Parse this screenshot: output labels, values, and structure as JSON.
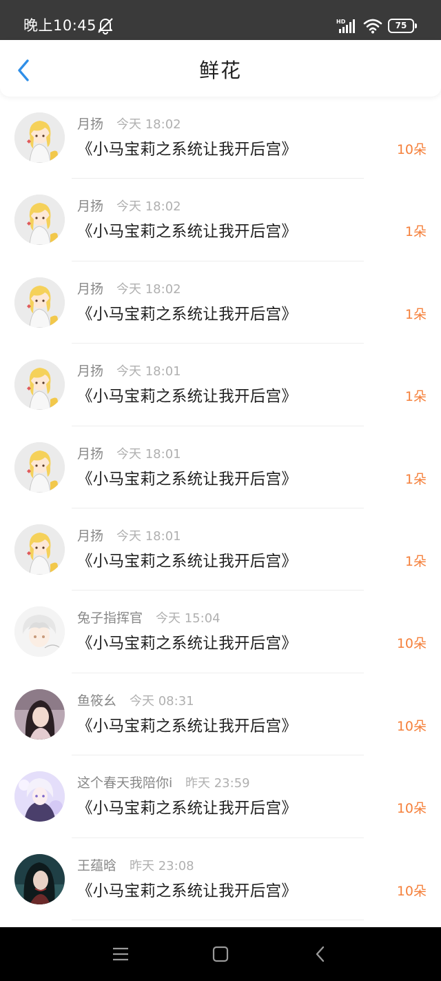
{
  "status_bar": {
    "time": "晚上10:45",
    "icons": [
      "mute-icon",
      "hd-signal-icon",
      "wifi-icon",
      "battery-icon"
    ],
    "battery_level": "75"
  },
  "header": {
    "back_icon": "chevron-left-icon",
    "title": "鲜花"
  },
  "colors": {
    "accent": "#2f8fe8",
    "flower_count": "#f5803b",
    "username": "#888888",
    "timestamp": "#b0b0b0",
    "status_bar_bg": "#3a3a3a",
    "nav_bar_bg": "#000000"
  },
  "items": [
    {
      "user": "月扬",
      "time": "今天 18:02",
      "book": "《小马宝莉之系统让我开后宫》",
      "count": "10朵",
      "avatar": "anime-avatar-blonde"
    },
    {
      "user": "月扬",
      "time": "今天 18:02",
      "book": "《小马宝莉之系统让我开后宫》",
      "count": "1朵",
      "avatar": "anime-avatar-blonde"
    },
    {
      "user": "月扬",
      "time": "今天 18:02",
      "book": "《小马宝莉之系统让我开后宫》",
      "count": "1朵",
      "avatar": "anime-avatar-blonde"
    },
    {
      "user": "月扬",
      "time": "今天 18:01",
      "book": "《小马宝莉之系统让我开后宫》",
      "count": "1朵",
      "avatar": "anime-avatar-blonde"
    },
    {
      "user": "月扬",
      "time": "今天 18:01",
      "book": "《小马宝莉之系统让我开后宫》",
      "count": "1朵",
      "avatar": "anime-avatar-blonde"
    },
    {
      "user": "月扬",
      "time": "今天 18:01",
      "book": "《小马宝莉之系统让我开后宫》",
      "count": "1朵",
      "avatar": "anime-avatar-blonde"
    },
    {
      "user": "兔子指挥官",
      "time": "今天 15:04",
      "book": "《小马宝莉之系统让我开后宫》",
      "count": "10朵",
      "avatar": "anime-avatar-white-hair"
    },
    {
      "user": "鱼筱幺",
      "time": "今天 08:31",
      "book": "《小马宝莉之系统让我开后宫》",
      "count": "10朵",
      "avatar": "portrait-avatar-dark-hair"
    },
    {
      "user": "这个春天我陪你i",
      "time": "昨天 23:59",
      "book": "《小马宝莉之系统让我开后宫》",
      "count": "10朵",
      "avatar": "anime-avatar-purple"
    },
    {
      "user": "王蕴晗",
      "time": "昨天 23:08",
      "book": "《小马宝莉之系统让我开后宫》",
      "count": "10朵",
      "avatar": "portrait-avatar-teal"
    }
  ],
  "nav_bar": {
    "buttons": [
      "menu-icon",
      "home-icon",
      "back-icon"
    ]
  }
}
